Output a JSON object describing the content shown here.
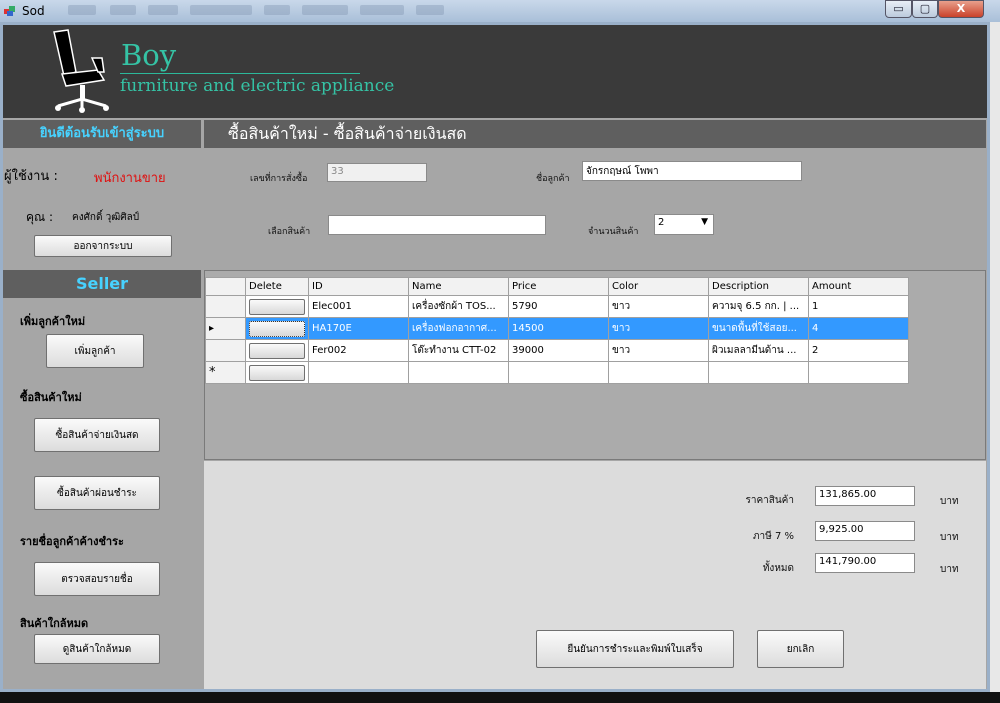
{
  "window": {
    "title": "Sod",
    "buttons": {
      "minimize": "▭",
      "maximize": "▢",
      "close": "X"
    }
  },
  "header": {
    "logo_title": "Boy",
    "logo_subtitle": "furniture and electric appliance"
  },
  "sidebar": {
    "welcome": "ยินดีต้อนรับเข้าสู่ระบบ",
    "user_label": "ผู้ใช้งาน :",
    "user_role": "พนักงานขาย",
    "name_label": "คุณ :",
    "name_value": "คงศักดิ์ วุฒิศิลป์",
    "logout_button": "ออกจากระบบ",
    "seller_title": "Seller",
    "sections": [
      {
        "label": "เพิ่มลูกค้าใหม่",
        "button": "เพิ่มลูกค้า"
      },
      {
        "label": "ซื้อสินค้าใหม่",
        "button": "ซื้อสินค้าจ่ายเงินสด"
      },
      {
        "label": "",
        "button": "ซื้อสินค้าผ่อนชำระ"
      },
      {
        "label": "รายชื่อลูกค้าค้างชำระ",
        "button": "ตรวจสอบรายชื่อ"
      },
      {
        "label": "สินค้าใกล้หมด",
        "button": "ดูสินค้าใกล้หมด"
      }
    ]
  },
  "content": {
    "title": "ซื้อสินค้าใหม่ - ซื้อสินค้าจ่ายเงินสด",
    "form": {
      "order_no_label": "เลขที่การสั่งซื้อ",
      "order_no_value": "33",
      "customer_label": "ชื่อลูกค้า",
      "customer_value": "จักรกฤษณ์ โพพา",
      "product_label": "เลือกสินค้า",
      "product_value": "",
      "qty_label": "จำนวนสินค้า",
      "qty_value": "2"
    },
    "grid": {
      "columns": [
        "Delete",
        "ID",
        "Name",
        "Price",
        "Color",
        "Description",
        "Amount"
      ],
      "rows": [
        {
          "id": "Elec001",
          "name": "เครื่องซักผ้า TOS...",
          "price": "5790",
          "color": "ขาว",
          "description": "ความจุ 6.5 กก. | ...",
          "amount": "1"
        },
        {
          "id": "HA170E",
          "name": "เครื่องฟอกอากาศ...",
          "price": "14500",
          "color": "ขาว",
          "description": "ขนาดพื้นที่ใช้สอย...",
          "amount": "4"
        },
        {
          "id": "Fer002",
          "name": "โต๊ะทำงาน CTT-02",
          "price": "39000",
          "color": "ขาว",
          "description": "ผิวเมลลามีนด้าน ...",
          "amount": "2"
        }
      ],
      "new_row_marker": "*",
      "selected_marker": "▸"
    },
    "summary": {
      "subtotal_label": "ราคาสินค้า",
      "subtotal_value": "131,865.00",
      "tax_label": "ภาษี 7 %",
      "tax_value": "9,925.00",
      "total_label": "ทั้งหมด",
      "total_value": "141,790.00",
      "currency": "บาท"
    },
    "actions": {
      "confirm_button": "ยืนยันการชำระและพิมพ์ใบเสร็จ",
      "cancel_button": "ยกเลิก"
    }
  }
}
